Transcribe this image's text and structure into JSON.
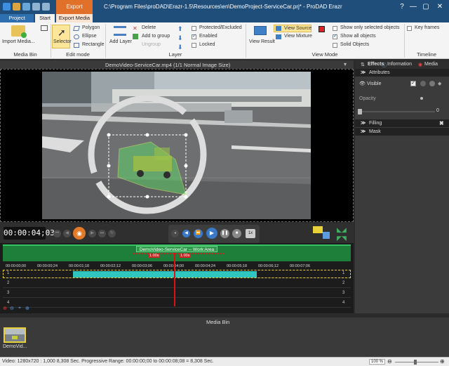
{
  "window": {
    "title": "C:\\Program Files\\proDAD\\Erazr-1.5\\Resources\\en\\DemoProject-ServiceCar.prj* - ProDAD Erazr",
    "context_tab": "Export",
    "controls": [
      "—",
      "▢",
      "✕"
    ]
  },
  "tabs": {
    "project": "Project",
    "start": "Start",
    "export_media": "Export Media"
  },
  "ribbon": {
    "media_bin": {
      "import": "Import Media...",
      "label": "Media Bin"
    },
    "edit_mode": {
      "selector": "Selector",
      "polygon": "Polygon",
      "ellipse": "Ellipse",
      "rectangle": "Rectangle",
      "label": "Edit mode"
    },
    "layer": {
      "add_layer": "Add Layer",
      "delete": "Delete",
      "add_to_group": "Add to group",
      "ungroup": "Ungroup",
      "protected": "Protected/Excluded",
      "enabled": "Enabled",
      "locked": "Locked",
      "label": "Layer"
    },
    "view_mode": {
      "view_result": "View Result",
      "view_source": "View Source",
      "view_mixture": "View Mixture",
      "show_selected": "Show only selected objects",
      "show_all": "Show all objects",
      "solid": "Solid Objects",
      "label": "View Mode"
    },
    "timeline": {
      "key_frames": "Key frames",
      "label": "Timeline"
    }
  },
  "preview": {
    "header": "DemoVideo-ServiceCar.mp4   (1/1  Normal Image Size)"
  },
  "right_panel": {
    "tabs": [
      "Effects",
      "Information",
      "Media"
    ],
    "attributes": "Attributes",
    "visible": "Visible",
    "opacity": "Opacity",
    "opacity_value": "0",
    "filling": "Filling",
    "mask": "Mask"
  },
  "transport": {
    "timecode": "00:00:04;03",
    "speed": "1x"
  },
  "timeline": {
    "work_area": "DemoVideo-ServiceCar -- Work Area",
    "marker_a": "1.00s",
    "marker_b": "1.00s",
    "ticks": [
      "00:00:00;00",
      "00:00:00;24",
      "00:00:01;18",
      "00:00:02;12",
      "00:00:03;06",
      "00:00:04;00",
      "00:00:04;24",
      "00:00:05;18",
      "00:00:06;12",
      "00:00:07;06"
    ],
    "tracks": [
      "1",
      "2",
      "3",
      "4"
    ]
  },
  "media_bin": {
    "title": "Media Bin",
    "item": "DemoVid..."
  },
  "status": {
    "text": "Video: 1280x720 : 1,000   8,308 Sec.   Progressive   Range: 00:00:00;00 to 00:00:08;08 = 8,308 Sec.",
    "zoom": "100 %"
  },
  "colors": {
    "accent": "#1f4e7a",
    "export": "#e0702a",
    "selection": "#5fd36a",
    "clip": "#2fc6c0",
    "playhead": "#dd1111"
  }
}
